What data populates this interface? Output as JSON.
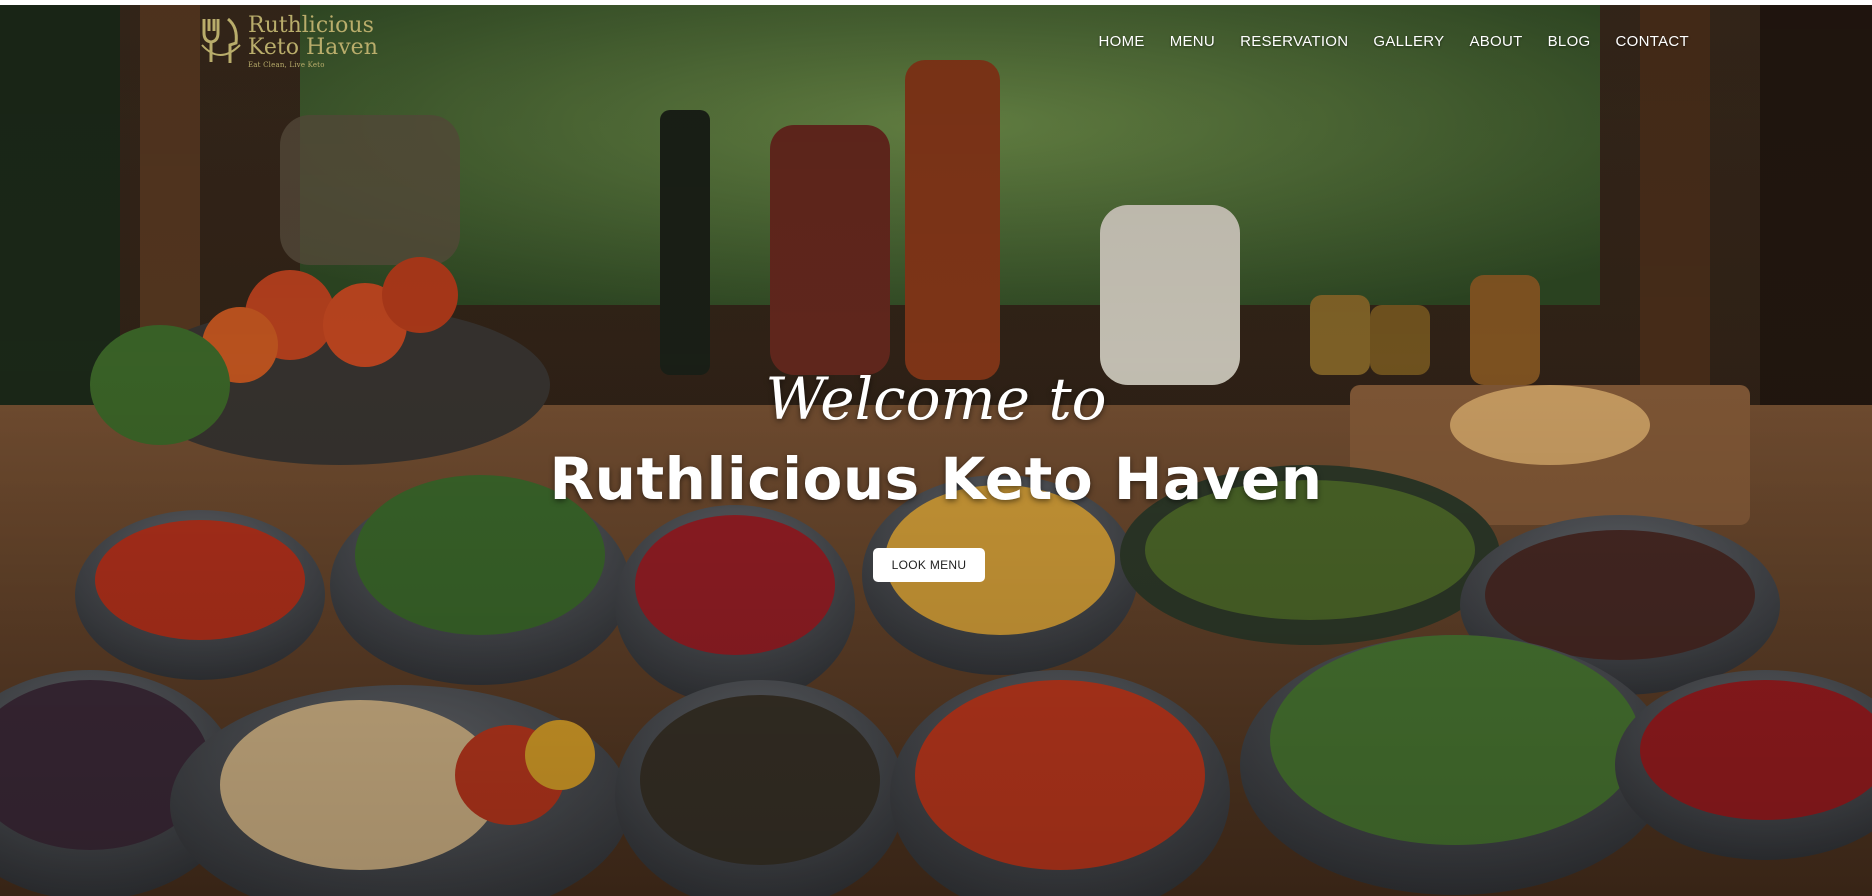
{
  "brand": {
    "name_line1": "Ruthlicious",
    "name_line2": "Keto Haven",
    "tagline": "Eat Clean, Live Keto",
    "logo_icon": "fork-knife-icon",
    "accent_color": "#b9ad6b"
  },
  "nav": {
    "items": [
      {
        "label": "HOME"
      },
      {
        "label": "MENU"
      },
      {
        "label": "RESERVATION"
      },
      {
        "label": "GALLERY"
      },
      {
        "label": "ABOUT"
      },
      {
        "label": "BLOG"
      },
      {
        "label": "CONTACT"
      }
    ]
  },
  "hero": {
    "welcome": "Welcome to",
    "title": "Ruthlicious Keto Haven",
    "button_label": "LOOK MENU",
    "background_description": "hero-background-photo"
  }
}
